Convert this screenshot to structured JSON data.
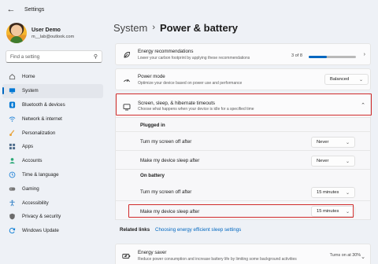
{
  "window": {
    "title": "Settings",
    "back_icon": "back-arrow-icon"
  },
  "user": {
    "name": "User Demo",
    "email": "m__lab@outlook.com"
  },
  "search": {
    "placeholder": "Find a setting"
  },
  "nav": [
    {
      "label": "Home",
      "icon": "home-icon",
      "color": "#6b6b6b"
    },
    {
      "label": "System",
      "icon": "system-icon",
      "color": "#0078d4",
      "active": true
    },
    {
      "label": "Bluetooth & devices",
      "icon": "bluetooth-icon",
      "color": "#0078d4"
    },
    {
      "label": "Network & internet",
      "icon": "wifi-icon",
      "color": "#2b88d8"
    },
    {
      "label": "Personalization",
      "icon": "brush-icon",
      "color": "#e8a33a"
    },
    {
      "label": "Apps",
      "icon": "apps-icon",
      "color": "#4d6b8a"
    },
    {
      "label": "Accounts",
      "icon": "person-icon",
      "color": "#2aa876"
    },
    {
      "label": "Time & language",
      "icon": "globe-clock-icon",
      "color": "#2b88d8"
    },
    {
      "label": "Gaming",
      "icon": "gamepad-icon",
      "color": "#777777"
    },
    {
      "label": "Accessibility",
      "icon": "accessibility-icon",
      "color": "#3a86c8"
    },
    {
      "label": "Privacy & security",
      "icon": "shield-icon",
      "color": "#6b6b6b"
    },
    {
      "label": "Windows Update",
      "icon": "update-icon",
      "color": "#0078d4"
    }
  ],
  "breadcrumb": {
    "parent": "System",
    "separator": "›",
    "current": "Power & battery"
  },
  "energy": {
    "title": "Energy recommendations",
    "desc": "Lower your carbon footprint by applying these recommendations",
    "count": "3 of 8",
    "progress": 0.375
  },
  "power_mode": {
    "title": "Power mode",
    "desc": "Optimize your device based on power use and performance",
    "value": "Balanced"
  },
  "screen_sleep": {
    "title": "Screen, sleep, & hibernate timeouts",
    "desc": "Choose what happens when your device is idle for a specified time",
    "plugged_in": {
      "heading": "Plugged in",
      "screen_off_label": "Turn my screen off after",
      "screen_off_value": "Never",
      "sleep_label": "Make my device sleep after",
      "sleep_value": "Never"
    },
    "on_battery": {
      "heading": "On battery",
      "screen_off_label": "Turn my screen off after",
      "screen_off_value": "15 minutes",
      "sleep_label": "Make my device sleep after",
      "sleep_value": "15 minutes"
    }
  },
  "related": {
    "label": "Related links",
    "link": "Choosing energy efficient sleep settings"
  },
  "energy_saver": {
    "title": "Energy saver",
    "desc": "Reduce power consumption and increase battery life by limiting some background activities",
    "status": "Turns on at 30%"
  },
  "colors": {
    "accent": "#0067c0",
    "highlight": "#d02b2b"
  }
}
